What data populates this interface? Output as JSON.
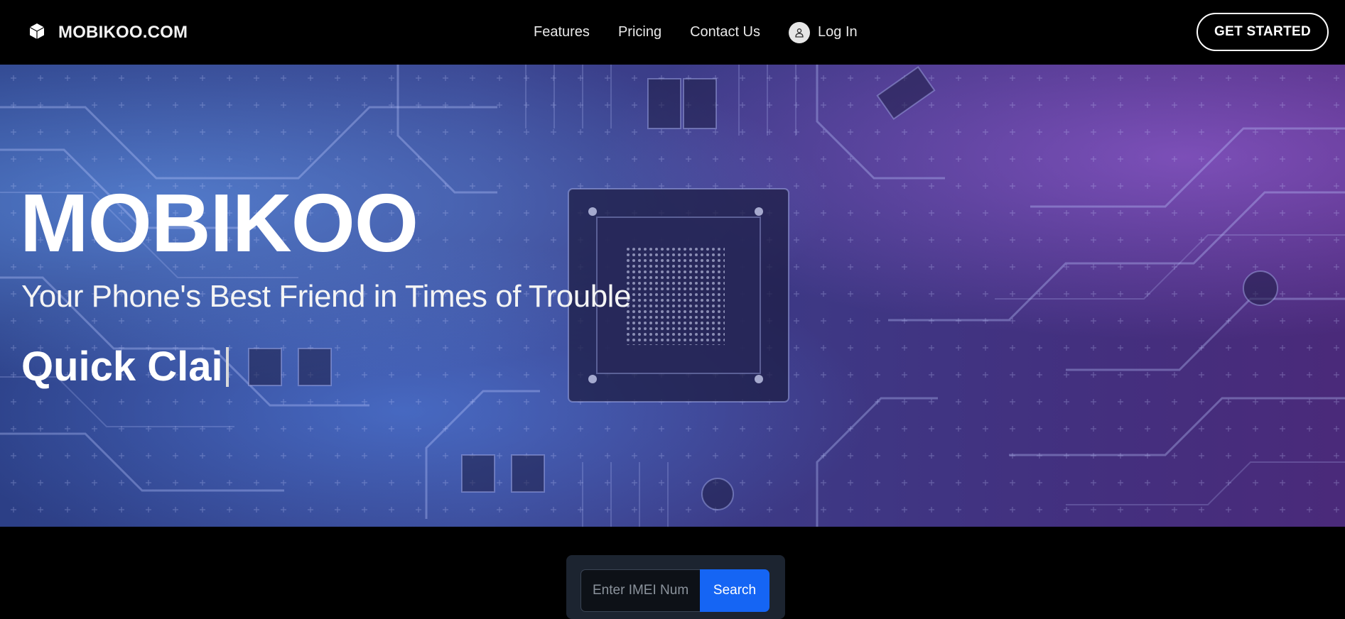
{
  "brand": {
    "name": "MOBIKOO.COM",
    "icon": "cube-icon"
  },
  "nav": {
    "links": [
      "Features",
      "Pricing",
      "Contact Us"
    ],
    "login_label": "Log In",
    "login_icon": "user-icon",
    "cta_label": "GET STARTED"
  },
  "hero": {
    "title": "MOBIKOO",
    "subtitle": "Your Phone's Best Friend in Times of Trouble",
    "typed_text": "Quick Clai"
  },
  "search": {
    "placeholder": "Enter IMEI Number",
    "button_label": "Search"
  },
  "colors": {
    "accent": "#1565f4",
    "background": "#000000",
    "hero_left": "#2c3f86",
    "hero_right": "#4a2a7a"
  }
}
